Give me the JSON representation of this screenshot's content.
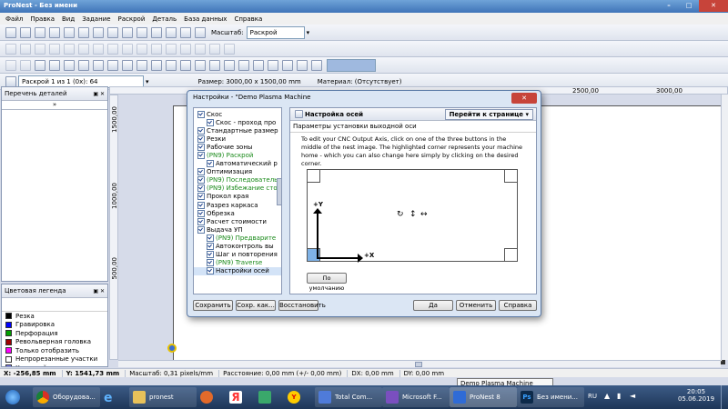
{
  "window": {
    "title": "ProNest - Без имени"
  },
  "menu": [
    "Файл",
    "Правка",
    "Вид",
    "Задание",
    "Раскрой",
    "Деталь",
    "База данных",
    "Справка"
  ],
  "toolbar1": {
    "zoom_label": "Масштаб:",
    "zoom_value": "Раскрой"
  },
  "toolbar3": {
    "nest_select": "Раскрой 1 из 1 (0х): 64",
    "size_label": "Размер: 3000,00 x 1500,00 mm",
    "material_label": "Материал: (Отсутствует)"
  },
  "parts_panel": {
    "title": "Перечень деталей"
  },
  "legend_panel": {
    "title": "Цветовая легенда",
    "items": [
      {
        "label": "Резка",
        "color": "#000000"
      },
      {
        "label": "Гравировка",
        "color": "#0000ff"
      },
      {
        "label": "Перфорация",
        "color": "#00a000"
      },
      {
        "label": "Револьверная головка",
        "color": "#a00000"
      },
      {
        "label": "Только отобразить",
        "color": "#ff00ff"
      },
      {
        "label": "Непрорезанные участки",
        "color": "#ffffff"
      },
      {
        "label": "Холостой ход",
        "color": "#8080ff"
      }
    ]
  },
  "ruler": {
    "top_ticks": [
      "2500,00",
      "3000,00"
    ],
    "left_ticks": [
      "1500,00",
      "1000,00",
      "500,00"
    ]
  },
  "dialog": {
    "title": "Настройки - \"Demo Plasma Machine",
    "tree": [
      {
        "label": "Скос",
        "indent": 1,
        "style": "normal"
      },
      {
        "label": "Скос - проход про",
        "indent": 2,
        "style": "normal"
      },
      {
        "label": "Стандартные размер",
        "indent": 1,
        "style": "normal"
      },
      {
        "label": "Резки",
        "indent": 1,
        "style": "normal"
      },
      {
        "label": "Рабочие зоны",
        "indent": 1,
        "style": "normal"
      },
      {
        "label": "(PN9) Раскрой",
        "indent": 1,
        "style": "green"
      },
      {
        "label": "Автоматический р",
        "indent": 2,
        "style": "normal"
      },
      {
        "label": "Оптимизация",
        "indent": 1,
        "style": "normal"
      },
      {
        "label": "(PN9) Последователь",
        "indent": 1,
        "style": "green"
      },
      {
        "label": "(PN9) Избежание стол",
        "indent": 1,
        "style": "green"
      },
      {
        "label": "Прокол края",
        "indent": 1,
        "style": "normal"
      },
      {
        "label": "Разрез каркаса",
        "indent": 1,
        "style": "normal"
      },
      {
        "label": "Обрезка",
        "indent": 1,
        "style": "normal"
      },
      {
        "label": "Расчет стоимости",
        "indent": 1,
        "style": "normal"
      },
      {
        "label": "Выдача УП",
        "indent": 1,
        "style": "normal"
      },
      {
        "label": "(PN9) Предварите",
        "indent": 2,
        "style": "green"
      },
      {
        "label": "Автоконтроль вы",
        "indent": 2,
        "style": "normal"
      },
      {
        "label": "Шаг и повторения",
        "indent": 2,
        "style": "normal"
      },
      {
        "label": "(PN9) Traverse",
        "indent": 2,
        "style": "green"
      },
      {
        "label": "Настройки осей",
        "indent": 2,
        "style": "selected"
      }
    ],
    "header_title": "Настройка осей",
    "goto_button": "Перейти к странице",
    "subtitle": "Параметры установки выходной оси",
    "description": "To edit your CNC Output Axis, click on one of the three buttons in the middle of the nest image.  The highlighted corner represents your machine home - which you can also change here simply by clicking on the desired corner.",
    "axis_y": "+Y",
    "axis_x": "+X",
    "defaults_button": "По умолчанию",
    "save_button": "Сохранить",
    "save_as_button": "Сохр. как...",
    "restore_button": "Восстановить",
    "ok_button": "Да",
    "cancel_button": "Отменить",
    "help_button": "Справка"
  },
  "statusbar": {
    "x": "X: -256,85 mm",
    "y": "Y: 1541,73 mm",
    "scale": "Масштаб: 0,31 pixels/mm",
    "distance": "Расстояние: 0,00 mm (+/- 0,00 mm)",
    "dx": "DX: 0,00 mm",
    "dy": "DY: 0,00 mm"
  },
  "taskbar": {
    "tooltip": "Demo Plasma Machine",
    "items": [
      "Оборудова...",
      "pronest",
      "Total Com...",
      "Microsoft F...",
      "ProNest 8",
      "Без имени..."
    ],
    "lang": "RU",
    "time": "20:05",
    "date": "05.06.2019"
  }
}
